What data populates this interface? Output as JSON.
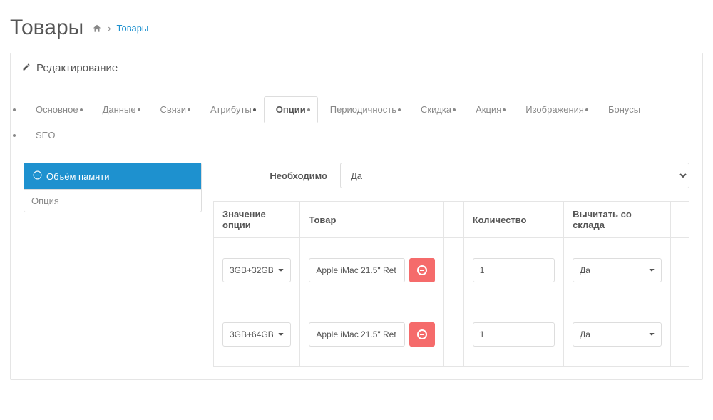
{
  "header": {
    "title": "Товары",
    "breadcrumb_link": "Товары"
  },
  "panel": {
    "heading": "Редактирование"
  },
  "tabs": [
    {
      "label": "Основное",
      "active": false
    },
    {
      "label": "Данные",
      "active": false
    },
    {
      "label": "Связи",
      "active": false
    },
    {
      "label": "Атрибуты",
      "active": false
    },
    {
      "label": "Опции",
      "active": true
    },
    {
      "label": "Периодичность",
      "active": false
    },
    {
      "label": "Скидка",
      "active": false
    },
    {
      "label": "Акция",
      "active": false
    },
    {
      "label": "Изображения",
      "active": false
    },
    {
      "label": "Бонусы",
      "active": false
    },
    {
      "label": "SEO",
      "active": false
    }
  ],
  "option_sidebar": {
    "active_item": "Объём памяти",
    "input_placeholder": "Опция"
  },
  "required": {
    "label": "Необходимо",
    "value": "Да"
  },
  "table": {
    "headers": {
      "value": "Значение опции",
      "product": "Товар",
      "quantity": "Количество",
      "subtract": "Вычитать со склада"
    },
    "rows": [
      {
        "value": "3GB+32GB",
        "product": "Apple iMac 21.5\" Ret",
        "quantity": "1",
        "subtract": "Да"
      },
      {
        "value": "3GB+64GB",
        "product": "Apple iMac 21.5\" Ret",
        "quantity": "1",
        "subtract": "Да"
      }
    ]
  }
}
